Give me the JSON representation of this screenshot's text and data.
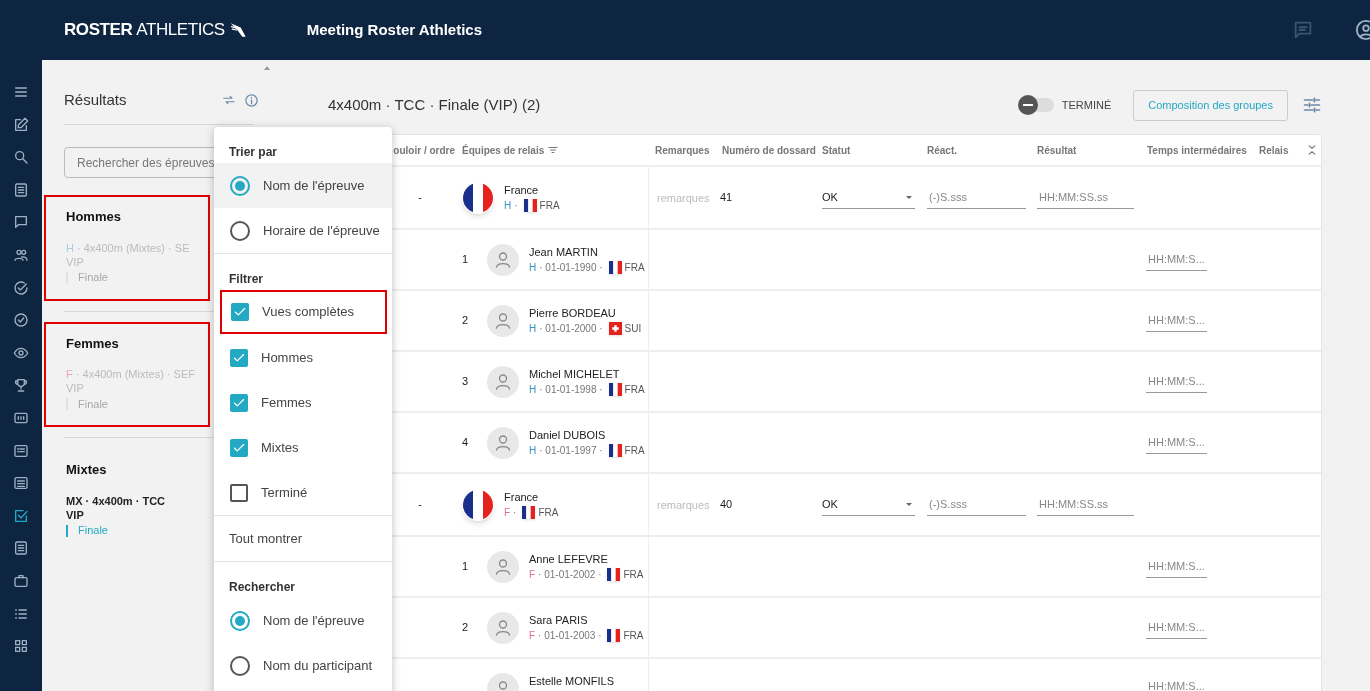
{
  "header": {
    "logo_bold": "ROSTER",
    "logo_light": "ATHLETICS",
    "title": "Meeting Roster Athletics"
  },
  "sidebar": {
    "items": [
      {
        "selected": false
      },
      {
        "selected": false
      },
      {
        "selected": false
      },
      {
        "selected": false
      },
      {
        "selected": false
      },
      {
        "selected": false
      },
      {
        "selected": false
      },
      {
        "selected": false
      },
      {
        "selected": false
      },
      {
        "selected": false
      },
      {
        "selected": false
      },
      {
        "selected": false
      },
      {
        "selected": false
      },
      {
        "selected": true
      },
      {
        "selected": false
      },
      {
        "selected": false
      },
      {
        "selected": false
      },
      {
        "selected": false
      }
    ]
  },
  "events_panel": {
    "title": "Résultats",
    "search_placeholder": "Rechercher des épreuves",
    "groups": [
      {
        "title": "Hommes",
        "highlighted": true,
        "events": [
          {
            "prefix": "H",
            "color": "#a9cde3",
            "name": " · 4x400m (Mixtes) · SE",
            "line2": "VIP",
            "round": "Finale",
            "disabled": true
          }
        ]
      },
      {
        "title": "Femmes",
        "highlighted": true,
        "events": [
          {
            "prefix": "F",
            "color": "#eba6bf",
            "name": " · 4x400m (Mixtes) · SEF",
            "line2": "VIP",
            "round": "Finale",
            "disabled": true
          }
        ]
      },
      {
        "title": "Mixtes",
        "highlighted": false,
        "events": [
          {
            "prefix": "MX",
            "color": "#222222",
            "name": " · 4x400m · TCC",
            "line2": "VIP",
            "round": "Finale",
            "disabled": false
          }
        ]
      }
    ]
  },
  "main": {
    "title": "4x400m · TCC · Finale (VIP) (2)",
    "finished_toggle": {
      "label": "TERMINÉ",
      "on": false
    },
    "groups_button": "Composition des groupes"
  },
  "menu": {
    "sections": [
      {
        "kind": "radio",
        "title": "Trier par",
        "options": [
          {
            "label": "Nom de l'épreuve",
            "selected": true,
            "hovered": true,
            "highlighted": false
          },
          {
            "label": "Horaire de l'épreuve",
            "selected": false,
            "hovered": false,
            "highlighted": false
          }
        ]
      },
      {
        "kind": "checkbox",
        "title": "Filtrer",
        "options": [
          {
            "label": "Vues complètes",
            "checked": true,
            "highlighted": true
          },
          {
            "label": "Hommes",
            "checked": true,
            "highlighted": false
          },
          {
            "label": "Femmes",
            "checked": true,
            "highlighted": false
          },
          {
            "label": "Mixtes",
            "checked": true,
            "highlighted": false
          },
          {
            "label": "Terminé",
            "checked": false,
            "highlighted": false
          }
        ]
      },
      {
        "kind": "action",
        "label": "Tout montrer"
      },
      {
        "kind": "radio",
        "title": "Rechercher",
        "options": [
          {
            "label": "Nom de l'épreuve",
            "selected": true,
            "hovered": false,
            "highlighted": false
          },
          {
            "label": "Nom du participant",
            "selected": false,
            "hovered": false,
            "highlighted": false
          }
        ]
      }
    ]
  },
  "table": {
    "columns": [
      "ouloir / ordre",
      "Équipes de relais",
      "Remarques",
      "Numéro de dossard",
      "Statut",
      "Réact.",
      "Résultat",
      "Temps intermédaires",
      "Relais"
    ],
    "rows": [
      {
        "kind": "team",
        "lane": "-",
        "name": "France",
        "sex": "H",
        "color": "#3a8fc4",
        "separator": "·",
        "flag": {
          "kind": "tricolor"
        },
        "country": "FRA",
        "remarks_placeholder": "remarques",
        "bib": "41",
        "status": "OK",
        "reaction_placeholder": "(-)S.sss",
        "result_placeholder": "HH:MM:SS.ss"
      },
      {
        "kind": "athlete",
        "order": "1",
        "name": "Jean MARTIN",
        "sex": "H",
        "color": "#3a8fc4",
        "birthdate": "· 01-01-1990 ·",
        "flag": {
          "kind": "tricolor"
        },
        "country": "FRA",
        "split_placeholder": "HH:MM:S..."
      },
      {
        "kind": "athlete",
        "order": "2",
        "name": "Pierre BORDEAU",
        "sex": "H",
        "color": "#3a8fc4",
        "birthdate": "· 01-01-2000 ·",
        "flag": {
          "kind": "cross"
        },
        "country": "SUI",
        "split_placeholder": "HH:MM:S..."
      },
      {
        "kind": "athlete",
        "order": "3",
        "name": "Michel MICHELET",
        "sex": "H",
        "color": "#3a8fc4",
        "birthdate": "· 01-01-1998 ·",
        "flag": {
          "kind": "tricolor"
        },
        "country": "FRA",
        "split_placeholder": "HH:MM:S..."
      },
      {
        "kind": "athlete",
        "order": "4",
        "name": "Daniel DUBOIS",
        "sex": "H",
        "color": "#3a8fc4",
        "birthdate": "· 01-01-1997 ·",
        "flag": {
          "kind": "tricolor"
        },
        "country": "FRA",
        "split_placeholder": "HH:MM:S..."
      },
      {
        "kind": "team",
        "lane": "-",
        "name": "France",
        "sex": "F",
        "color": "#e0709a",
        "separator": "·",
        "flag": {
          "kind": "tricolor"
        },
        "country": "FRA",
        "remarks_placeholder": "remarques",
        "bib": "40",
        "status": "OK",
        "reaction_placeholder": "(-)S.sss",
        "result_placeholder": "HH:MM:SS.ss"
      },
      {
        "kind": "athlete",
        "order": "1",
        "name": "Anne LEFEVRE",
        "sex": "F",
        "color": "#e0709a",
        "birthdate": "· 01-01-2002 ·",
        "flag": {
          "kind": "tricolor"
        },
        "country": "FRA",
        "split_placeholder": "HH:MM:S..."
      },
      {
        "kind": "athlete",
        "order": "2",
        "name": "Sara PARIS",
        "sex": "F",
        "color": "#e0709a",
        "birthdate": "· 01-01-2003 ·",
        "flag": {
          "kind": "tricolor"
        },
        "country": "FRA",
        "split_placeholder": "HH:MM:S..."
      },
      {
        "kind": "athlete_cut",
        "name": "Estelle MONFILS",
        "split_placeholder": "HH:MM:S..."
      }
    ]
  }
}
